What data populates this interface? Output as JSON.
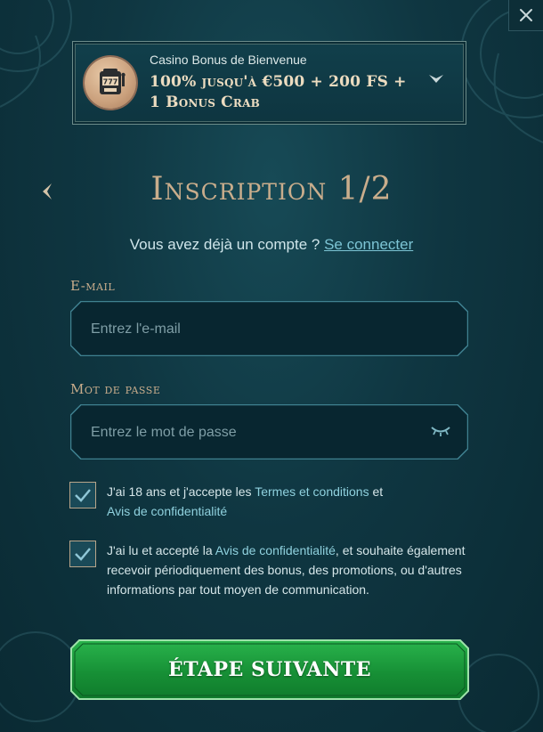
{
  "bonus": {
    "subtitle": "Casino Bonus de Bienvenue",
    "title": "100% jusqu'à €500 + 200 FS + 1 Bonus Crab",
    "icon": "slot-machine-icon"
  },
  "header": {
    "title": "Inscription 1/2"
  },
  "login_prompt": {
    "text": "Vous avez déjà un compte ?",
    "link": "Se connecter"
  },
  "form": {
    "email": {
      "label": "E-mail",
      "placeholder": "Entrez l'e-mail",
      "value": ""
    },
    "password": {
      "label": "Mot de passe",
      "placeholder": "Entrez le mot de passe",
      "value": ""
    }
  },
  "consents": [
    {
      "checked": true,
      "text_before": "J'ai 18 ans et j'accepte les ",
      "link1": "Termes et conditions",
      "text_middle": " et ",
      "link2": "Avis de confidentialité"
    },
    {
      "checked": true,
      "text_before": "J'ai lu et accepté la ",
      "link": "Avis de confidentialité",
      "text_after": ", et souhaite également recevoir périodiquement des bonus, des promotions, ou d'autres informations par tout moyen de communication."
    }
  ],
  "actions": {
    "next_label": "ÉTAPE SUIVANTE"
  },
  "colors": {
    "accent_gold": "#c9ad8c",
    "link": "#7cc4d4",
    "cta_green": "#179036",
    "background": "#0f3641"
  }
}
